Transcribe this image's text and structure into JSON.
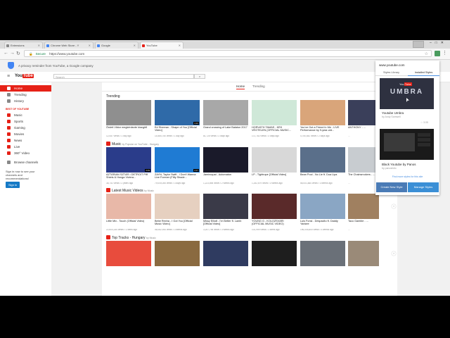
{
  "browser": {
    "tabs": [
      {
        "label": "Extensions",
        "color": "#888888",
        "active": false
      },
      {
        "label": "Chrome Web Store - Y",
        "color": "#4285f4",
        "active": false
      },
      {
        "label": "Google",
        "color": "#4285f4",
        "active": false
      },
      {
        "label": "YouTube",
        "color": "#e62117",
        "active": true
      }
    ],
    "secure_label": "Secure",
    "url": "https://www.youtube.com"
  },
  "banner": {
    "text": "A privacy reminder from YouTube, a Google company"
  },
  "youtube": {
    "logo_you": "You",
    "logo_tube": "Tube",
    "search_placeholder": "Search",
    "sidebar": {
      "items": [
        {
          "label": "Home",
          "active": true
        },
        {
          "label": "Trending",
          "active": false
        },
        {
          "label": "History",
          "active": false
        }
      ],
      "best_heading": "BEST OF YOUTUBE",
      "best_items": [
        "Music",
        "Sports",
        "Gaming",
        "Movies",
        "News",
        "Live",
        "360° Video"
      ],
      "browse": "Browse channels",
      "signin_note": "Sign in now to see your channels and recommendations!",
      "signin_button": "Sign in"
    },
    "tabs": [
      "Home",
      "Trending"
    ],
    "sections": [
      {
        "title": "Trending",
        "chip_color": "",
        "by": "",
        "videos": [
          {
            "title": "Ördeti Viktor megkérdezte kisegítő",
            "meta": "12,087 views • 1 day ago",
            "dur": "",
            "color": "#8f8f8f"
          },
          {
            "title": "Ed Sheeran - Shape of You [Official Video]",
            "meta": "14,584,750 views • 1 day ago",
            "dur": "4:24",
            "color": "#2f6aa8"
          },
          {
            "title": "Grand crossing of Lake Balaton 2017",
            "meta": "81,725 views • 2 days ago",
            "dur": "",
            "color": "#a8a8a8"
          },
          {
            "title": "HORVÁTH TAMÁS - KÉK VÉGTELEN (OFFICIAL MUSIC...",
            "meta": "172,782 views • 3 days ago",
            "dur": "",
            "color": "#cfe8d8"
          },
          {
            "title": "You've Got a Friend In Me - LIVE Performance by 9-year-old...",
            "meta": "4,750,642 views • 2 days ago",
            "dur": "",
            "color": "#d9a57a"
          },
          {
            "title": "ANTHONY - ...",
            "meta": "...",
            "dur": "",
            "color": "#3a3f5a"
          }
        ]
      },
      {
        "title": "Music",
        "chip_color": "#e62117",
        "by": "by Popular on YouTube - Hungary",
        "videos": [
          {
            "title": "AZTÁRIAN SZTÁR • DETROIT Piff Shiets & Honga Viviera...",
            "meta": "38,741 views • 2 years ago",
            "dur": "3:49",
            "color": "#2a3c8a"
          },
          {
            "title": "ZAYN, Taylor Swift - I Don't Wanna Live Forever (Fifty Shade...",
            "meta": "79,005,055 views • 3 days ago",
            "dur": "4:17",
            "color": "#1f7bd3"
          },
          {
            "title": "Jamiroquai - Automaton",
            "meta": "1,223,898 views • 2 weeks ago",
            "dur": "",
            "color": "#1a1a2a"
          },
          {
            "title": "LP - Tightrope [Official Video]",
            "meta": "1,252,679 views • 3 weeks ago",
            "dur": "",
            "color": "#d8d8d8"
          },
          {
            "title": "Bean Pool - No Lie ft. Dua Lipa",
            "meta": "56,001,884 views • 3 weeks ago",
            "dur": "",
            "color": "#5a6f8a"
          },
          {
            "title": "The Chainsmokers - ...",
            "meta": "...",
            "dur": "",
            "color": "#c8ccd0"
          }
        ]
      },
      {
        "title": "Latest Music Videos",
        "chip_color": "#e62117",
        "by": "by Music",
        "videos": [
          {
            "title": "Little Mix - Touch (Official Video)",
            "meta": "22,604,334 views • 1 week ago",
            "dur": "",
            "color": "#e8b8a8"
          },
          {
            "title": "Bebe Rexha - I Got You [Official Music Video]",
            "meta": "46,082,944 views • 3 weeks ago",
            "dur": "",
            "color": "#e6d0c0"
          },
          {
            "title": "Missy Elliott - I'm Better ft. Lamb [Official Video]",
            "meta": "3,257,796 views • 3 weeks ago",
            "dur": "",
            "color": "#3a3a48"
          },
          {
            "title": "YOUNG G - KOLOZSVÁRI (OFFICIAL MUSIC VIDEO)",
            "meta": "101,999 views • 1 week ago",
            "dur": "",
            "color": "#5a2a2a"
          },
          {
            "title": "Luis Fonsi - Despacito ft. Daddy Yankee",
            "meta": "196,005,800 views • 3 weeks ago",
            "dur": "",
            "color": "#8aa6c4"
          },
          {
            "title": "Taco Gamble - ...",
            "meta": "...",
            "dur": "",
            "color": "#a08060"
          }
        ]
      },
      {
        "title": "Top Tracks - Hungary",
        "chip_color": "#e62117",
        "by": "by Music",
        "videos": [
          {
            "title": "",
            "meta": "",
            "dur": "",
            "color": "#e84c3d"
          },
          {
            "title": "",
            "meta": "",
            "dur": "",
            "color": "#8a6a40"
          },
          {
            "title": "",
            "meta": "",
            "dur": "",
            "color": "#2f3b60"
          },
          {
            "title": "",
            "meta": "",
            "dur": "",
            "color": "#1e1e1e"
          },
          {
            "title": "",
            "meta": "",
            "dur": "",
            "color": "#6a7078"
          },
          {
            "title": "",
            "meta": "",
            "dur": "",
            "color": "#9a8a78"
          }
        ]
      }
    ]
  },
  "popup": {
    "site": "www.youtube.com",
    "tabs": [
      "Styles Library",
      "Installed Styles"
    ],
    "styles": [
      {
        "name": "Youtube Umbra",
        "by": "by Andy Samwell",
        "rating": "☆ 3.05",
        "thumb_text": "UMBRA",
        "color": "#2e3140"
      },
      {
        "name": "Black Youtube by Panos",
        "by": "by panosfolio",
        "rating": "",
        "thumb_text": "",
        "color": "#1a1a1a"
      }
    ],
    "find_more": "Find more styles for this site",
    "create_button": "Create New Style",
    "manage_button": "Manage Styles"
  }
}
